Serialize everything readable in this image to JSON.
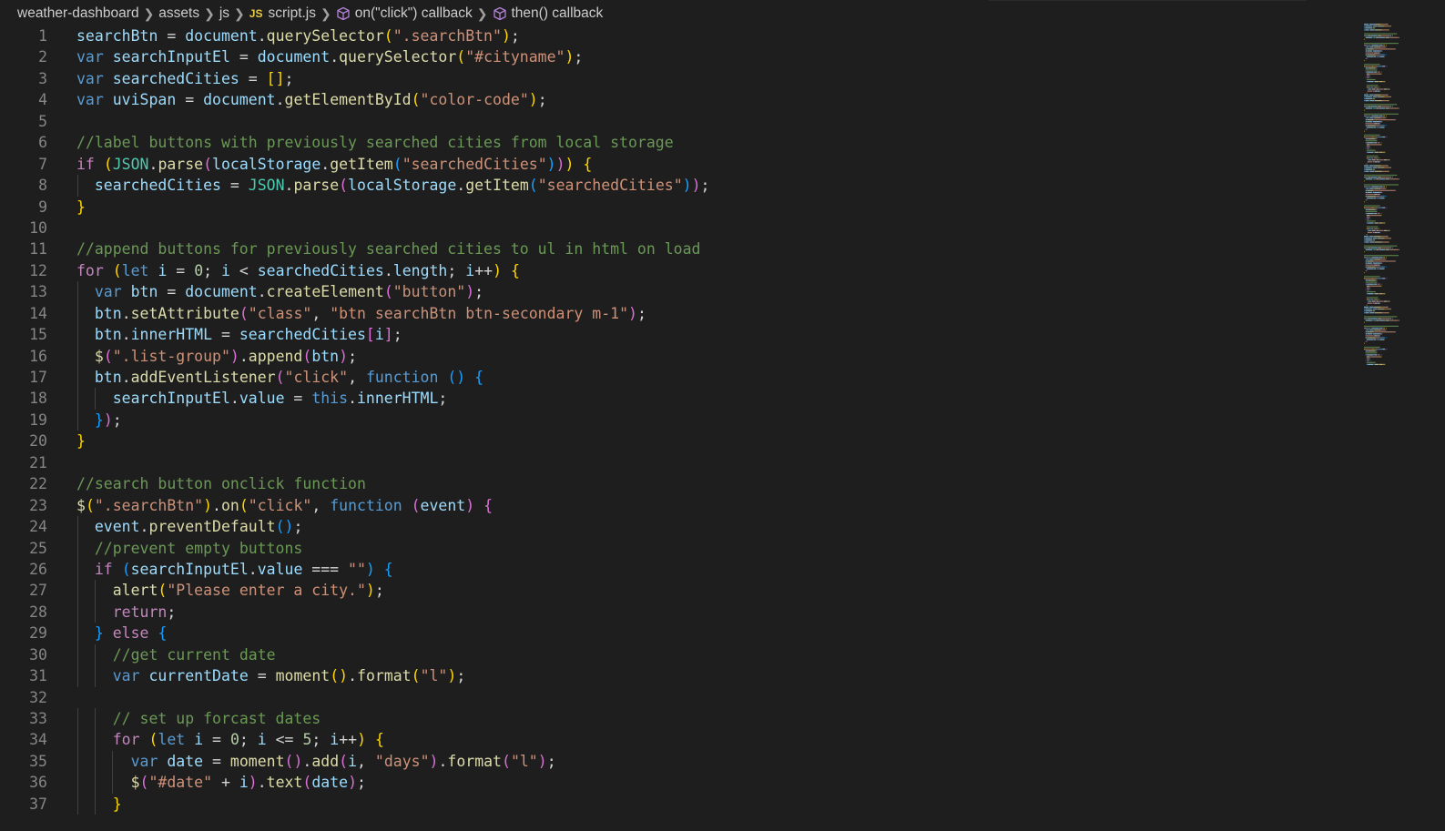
{
  "breadcrumb": {
    "items": [
      "weather-dashboard",
      "assets",
      "js",
      "script.js",
      "on(\"click\") callback",
      "then() callback"
    ],
    "file_icon": "JS"
  },
  "editor": {
    "lines": [
      [
        [
          "v",
          "searchBtn"
        ],
        [
          "p",
          " = "
        ],
        [
          "v",
          "document"
        ],
        [
          "p",
          "."
        ],
        [
          "f",
          "querySelector"
        ],
        [
          "b1",
          "("
        ],
        [
          "s",
          "\".searchBtn\""
        ],
        [
          "b1",
          ")"
        ],
        [
          "p",
          ";"
        ]
      ],
      [
        [
          "k",
          "var "
        ],
        [
          "v",
          "searchInputEl"
        ],
        [
          "p",
          " = "
        ],
        [
          "v",
          "document"
        ],
        [
          "p",
          "."
        ],
        [
          "f",
          "querySelector"
        ],
        [
          "b1",
          "("
        ],
        [
          "s",
          "\"#cityname\""
        ],
        [
          "b1",
          ")"
        ],
        [
          "p",
          ";"
        ]
      ],
      [
        [
          "k",
          "var "
        ],
        [
          "v",
          "searchedCities"
        ],
        [
          "p",
          " = "
        ],
        [
          "b1",
          "[]"
        ],
        [
          "p",
          ";"
        ]
      ],
      [
        [
          "k",
          "var "
        ],
        [
          "v",
          "uviSpan"
        ],
        [
          "p",
          " = "
        ],
        [
          "v",
          "document"
        ],
        [
          "p",
          "."
        ],
        [
          "f",
          "getElementById"
        ],
        [
          "b1",
          "("
        ],
        [
          "s",
          "\"color-code\""
        ],
        [
          "b1",
          ")"
        ],
        [
          "p",
          ";"
        ]
      ],
      [],
      [
        [
          "c",
          "//label buttons with previously searched cities from local storage"
        ]
      ],
      [
        [
          "ct",
          "if "
        ],
        [
          "b1",
          "("
        ],
        [
          "o",
          "JSON"
        ],
        [
          "p",
          "."
        ],
        [
          "f",
          "parse"
        ],
        [
          "b2",
          "("
        ],
        [
          "v",
          "localStorage"
        ],
        [
          "p",
          "."
        ],
        [
          "f",
          "getItem"
        ],
        [
          "b3",
          "("
        ],
        [
          "s",
          "\"searchedCities\""
        ],
        [
          "b3",
          ")"
        ],
        [
          "b2",
          ")"
        ],
        [
          "b1",
          ")"
        ],
        [
          "p",
          " "
        ],
        [
          "b1",
          "{"
        ]
      ],
      [
        [
          "p",
          "  "
        ],
        [
          "v",
          "searchedCities"
        ],
        [
          "p",
          " = "
        ],
        [
          "o",
          "JSON"
        ],
        [
          "p",
          "."
        ],
        [
          "f",
          "parse"
        ],
        [
          "b2",
          "("
        ],
        [
          "v",
          "localStorage"
        ],
        [
          "p",
          "."
        ],
        [
          "f",
          "getItem"
        ],
        [
          "b3",
          "("
        ],
        [
          "s",
          "\"searchedCities\""
        ],
        [
          "b3",
          ")"
        ],
        [
          "b2",
          ")"
        ],
        [
          "p",
          ";"
        ]
      ],
      [
        [
          "b1",
          "}"
        ]
      ],
      [],
      [
        [
          "c",
          "//append buttons for previously searched cities to ul in html on load"
        ]
      ],
      [
        [
          "ct",
          "for "
        ],
        [
          "b1",
          "("
        ],
        [
          "k",
          "let "
        ],
        [
          "v",
          "i"
        ],
        [
          "p",
          " = "
        ],
        [
          "n",
          "0"
        ],
        [
          "p",
          "; "
        ],
        [
          "v",
          "i"
        ],
        [
          "p",
          " < "
        ],
        [
          "v",
          "searchedCities"
        ],
        [
          "p",
          "."
        ],
        [
          "v",
          "length"
        ],
        [
          "p",
          "; "
        ],
        [
          "v",
          "i"
        ],
        [
          "p",
          "++"
        ],
        [
          "b1",
          ")"
        ],
        [
          "p",
          " "
        ],
        [
          "b1",
          "{"
        ]
      ],
      [
        [
          "p",
          "  "
        ],
        [
          "k",
          "var "
        ],
        [
          "v",
          "btn"
        ],
        [
          "p",
          " = "
        ],
        [
          "v",
          "document"
        ],
        [
          "p",
          "."
        ],
        [
          "f",
          "createElement"
        ],
        [
          "b2",
          "("
        ],
        [
          "s",
          "\"button\""
        ],
        [
          "b2",
          ")"
        ],
        [
          "p",
          ";"
        ]
      ],
      [
        [
          "p",
          "  "
        ],
        [
          "v",
          "btn"
        ],
        [
          "p",
          "."
        ],
        [
          "f",
          "setAttribute"
        ],
        [
          "b2",
          "("
        ],
        [
          "s",
          "\"class\""
        ],
        [
          "p",
          ", "
        ],
        [
          "s",
          "\"btn searchBtn btn-secondary m-1\""
        ],
        [
          "b2",
          ")"
        ],
        [
          "p",
          ";"
        ]
      ],
      [
        [
          "p",
          "  "
        ],
        [
          "v",
          "btn"
        ],
        [
          "p",
          "."
        ],
        [
          "v",
          "innerHTML"
        ],
        [
          "p",
          " = "
        ],
        [
          "v",
          "searchedCities"
        ],
        [
          "b2",
          "["
        ],
        [
          "v",
          "i"
        ],
        [
          "b2",
          "]"
        ],
        [
          "p",
          ";"
        ]
      ],
      [
        [
          "p",
          "  "
        ],
        [
          "f",
          "$"
        ],
        [
          "b2",
          "("
        ],
        [
          "s",
          "\".list-group\""
        ],
        [
          "b2",
          ")"
        ],
        [
          "p",
          "."
        ],
        [
          "f",
          "append"
        ],
        [
          "b2",
          "("
        ],
        [
          "v",
          "btn"
        ],
        [
          "b2",
          ")"
        ],
        [
          "p",
          ";"
        ]
      ],
      [
        [
          "p",
          "  "
        ],
        [
          "v",
          "btn"
        ],
        [
          "p",
          "."
        ],
        [
          "f",
          "addEventListener"
        ],
        [
          "b2",
          "("
        ],
        [
          "s",
          "\"click\""
        ],
        [
          "p",
          ", "
        ],
        [
          "k",
          "function "
        ],
        [
          "b3",
          "()"
        ],
        [
          "p",
          " "
        ],
        [
          "b3",
          "{"
        ]
      ],
      [
        [
          "p",
          "    "
        ],
        [
          "v",
          "searchInputEl"
        ],
        [
          "p",
          "."
        ],
        [
          "v",
          "value"
        ],
        [
          "p",
          " = "
        ],
        [
          "k",
          "this"
        ],
        [
          "p",
          "."
        ],
        [
          "v",
          "innerHTML"
        ],
        [
          "p",
          ";"
        ]
      ],
      [
        [
          "p",
          "  "
        ],
        [
          "b3",
          "}"
        ],
        [
          "b2",
          ")"
        ],
        [
          "p",
          ";"
        ]
      ],
      [
        [
          "b1",
          "}"
        ]
      ],
      [],
      [
        [
          "c",
          "//search button onclick function"
        ]
      ],
      [
        [
          "f",
          "$"
        ],
        [
          "b1",
          "("
        ],
        [
          "s",
          "\".searchBtn\""
        ],
        [
          "b1",
          ")"
        ],
        [
          "p",
          "."
        ],
        [
          "f",
          "on"
        ],
        [
          "b1",
          "("
        ],
        [
          "s",
          "\"click\""
        ],
        [
          "p",
          ", "
        ],
        [
          "k",
          "function "
        ],
        [
          "b2",
          "("
        ],
        [
          "v",
          "event"
        ],
        [
          "b2",
          ")"
        ],
        [
          "p",
          " "
        ],
        [
          "b2",
          "{"
        ]
      ],
      [
        [
          "p",
          "  "
        ],
        [
          "v",
          "event"
        ],
        [
          "p",
          "."
        ],
        [
          "f",
          "preventDefault"
        ],
        [
          "b3",
          "()"
        ],
        [
          "p",
          ";"
        ]
      ],
      [
        [
          "p",
          "  "
        ],
        [
          "c",
          "//prevent empty buttons"
        ]
      ],
      [
        [
          "p",
          "  "
        ],
        [
          "ct",
          "if "
        ],
        [
          "b3",
          "("
        ],
        [
          "v",
          "searchInputEl"
        ],
        [
          "p",
          "."
        ],
        [
          "v",
          "value"
        ],
        [
          "p",
          " === "
        ],
        [
          "s",
          "\"\""
        ],
        [
          "b3",
          ")"
        ],
        [
          "p",
          " "
        ],
        [
          "b3",
          "{"
        ]
      ],
      [
        [
          "p",
          "    "
        ],
        [
          "f",
          "alert"
        ],
        [
          "b1",
          "("
        ],
        [
          "s",
          "\"Please enter a city.\""
        ],
        [
          "b1",
          ")"
        ],
        [
          "p",
          ";"
        ]
      ],
      [
        [
          "p",
          "    "
        ],
        [
          "ct",
          "return"
        ],
        [
          "p",
          ";"
        ]
      ],
      [
        [
          "p",
          "  "
        ],
        [
          "b3",
          "}"
        ],
        [
          "p",
          " "
        ],
        [
          "ct",
          "else"
        ],
        [
          "p",
          " "
        ],
        [
          "b3",
          "{"
        ]
      ],
      [
        [
          "p",
          "    "
        ],
        [
          "c",
          "//get current date"
        ]
      ],
      [
        [
          "p",
          "    "
        ],
        [
          "k",
          "var "
        ],
        [
          "v",
          "currentDate"
        ],
        [
          "p",
          " = "
        ],
        [
          "f",
          "moment"
        ],
        [
          "b1",
          "()"
        ],
        [
          "p",
          "."
        ],
        [
          "f",
          "format"
        ],
        [
          "b1",
          "("
        ],
        [
          "s",
          "\"l\""
        ],
        [
          "b1",
          ")"
        ],
        [
          "p",
          ";"
        ]
      ],
      [],
      [
        [
          "p",
          "    "
        ],
        [
          "c",
          "// set up forcast dates"
        ]
      ],
      [
        [
          "p",
          "    "
        ],
        [
          "ct",
          "for "
        ],
        [
          "b1",
          "("
        ],
        [
          "k",
          "let "
        ],
        [
          "v",
          "i"
        ],
        [
          "p",
          " = "
        ],
        [
          "n",
          "0"
        ],
        [
          "p",
          "; "
        ],
        [
          "v",
          "i"
        ],
        [
          "p",
          " <= "
        ],
        [
          "n",
          "5"
        ],
        [
          "p",
          "; "
        ],
        [
          "v",
          "i"
        ],
        [
          "p",
          "++"
        ],
        [
          "b1",
          ")"
        ],
        [
          "p",
          " "
        ],
        [
          "b1",
          "{"
        ]
      ],
      [
        [
          "p",
          "      "
        ],
        [
          "k",
          "var "
        ],
        [
          "v",
          "date"
        ],
        [
          "p",
          " = "
        ],
        [
          "f",
          "moment"
        ],
        [
          "b2",
          "()"
        ],
        [
          "p",
          "."
        ],
        [
          "f",
          "add"
        ],
        [
          "b2",
          "("
        ],
        [
          "v",
          "i"
        ],
        [
          "p",
          ", "
        ],
        [
          "s",
          "\"days\""
        ],
        [
          "b2",
          ")"
        ],
        [
          "p",
          "."
        ],
        [
          "f",
          "format"
        ],
        [
          "b2",
          "("
        ],
        [
          "s",
          "\"l\""
        ],
        [
          "b2",
          ")"
        ],
        [
          "p",
          ";"
        ]
      ],
      [
        [
          "p",
          "      "
        ],
        [
          "f",
          "$"
        ],
        [
          "b2",
          "("
        ],
        [
          "s",
          "\"#date\""
        ],
        [
          "p",
          " + "
        ],
        [
          "v",
          "i"
        ],
        [
          "b2",
          ")"
        ],
        [
          "p",
          "."
        ],
        [
          "f",
          "text"
        ],
        [
          "b2",
          "("
        ],
        [
          "v",
          "date"
        ],
        [
          "b2",
          ")"
        ],
        [
          "p",
          ";"
        ]
      ],
      [
        [
          "p",
          "    "
        ],
        [
          "b1",
          "}"
        ]
      ]
    ]
  },
  "colors": {
    "background": "#1e1e1e",
    "variable": "#9cdcfe",
    "keyword": "#569cd6",
    "control": "#c586c0",
    "function": "#dcdcaa",
    "string": "#ce9178",
    "number": "#b5cea8",
    "comment": "#6a9955",
    "type": "#4ec9b0",
    "bracket1": "#ffd700",
    "bracket2": "#da70d6",
    "bracket3": "#179fff"
  }
}
